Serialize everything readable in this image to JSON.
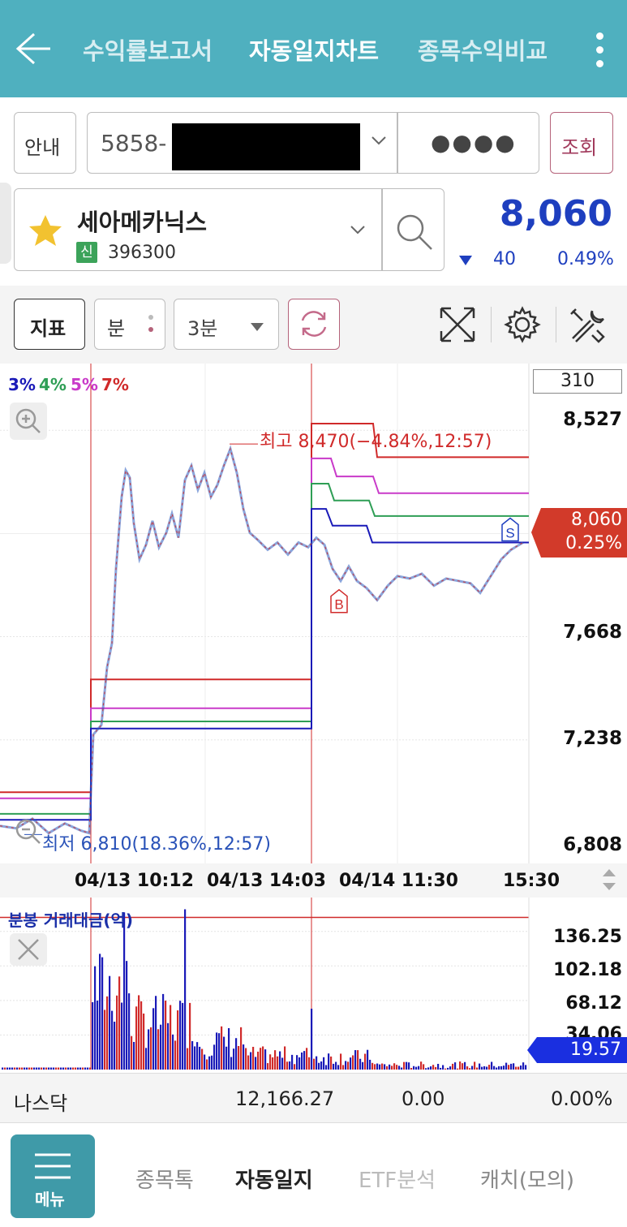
{
  "header": {
    "tabs": [
      {
        "label": "수익률보고서",
        "active": false
      },
      {
        "label": "자동일지차트",
        "active": true
      },
      {
        "label": "종목수익비교",
        "active": false
      }
    ]
  },
  "account": {
    "guide_label": "안내",
    "account_prefix": "5858-",
    "password_mask": "●●●●",
    "query_label": "조회"
  },
  "stock": {
    "name": "세아메카닉스",
    "badge": "신",
    "code": "396300",
    "price": "8,060",
    "change": "40",
    "change_pct": "0.49%",
    "change_direction": "down"
  },
  "toolbar": {
    "indicator_label": "지표",
    "period_label": "분",
    "interval_label": "3분"
  },
  "chart_legend": {
    "p3": "3%",
    "p4": "4%",
    "p5": "5%",
    "p7": "7%"
  },
  "chart_data": {
    "type": "candlestick",
    "interval": "3분",
    "count_box": "310",
    "ylim": [
      6808,
      8680
    ],
    "y_ticks": [
      "8,527",
      "7,668",
      "7,238",
      "6,808"
    ],
    "x_ticks": [
      "04/13 10:12",
      "04/13 14:03",
      "04/14 11:30",
      "15:30"
    ],
    "current_price_tag": "8,060",
    "current_pct_tag": "0.25%",
    "high_label": "최고 8,470(−4.84%,12:57)",
    "low_label": "최저 6,810(18.36%,12:57)",
    "high_value": 8470,
    "low_value": 6810,
    "markers": [
      "B",
      "S"
    ],
    "target_line_colors": {
      "3%": "#1a1ab8",
      "4%": "#2e9e55",
      "5%": "#c93ac9",
      "7%": "#d02a2a"
    },
    "volume_title": "분봉 거래대금(억)",
    "volume_ticks": [
      "136.25",
      "102.18",
      "68.12",
      "34.06"
    ],
    "volume_current": "19.57"
  },
  "index_bar": {
    "name": "나스닥",
    "value": "12,166.27",
    "change": "0.00",
    "change_pct": "0.00%"
  },
  "navbar": {
    "menu_label": "메뉴",
    "items": [
      {
        "label": "종목톡",
        "active": false
      },
      {
        "label": "자동일지",
        "active": true
      },
      {
        "label": "ETF분석",
        "active": false
      },
      {
        "label": "캐치(모의)",
        "active": false
      }
    ]
  },
  "colors": {
    "header_bg": "#4fb0bf",
    "up_red": "#d02a2a",
    "down_blue": "#1e3fbf",
    "menu_bg": "#3f9aa8"
  }
}
